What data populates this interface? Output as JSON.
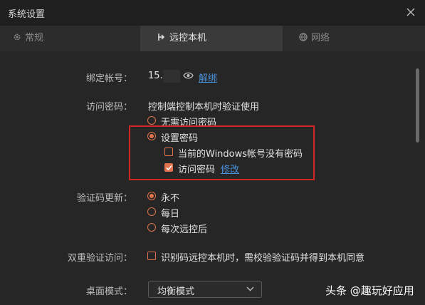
{
  "window": {
    "title": "系统设置"
  },
  "tabs": [
    {
      "label": "常规",
      "icon": "gear-icon"
    },
    {
      "label": "远控本机",
      "icon": "remote-control-icon"
    },
    {
      "label": "网络",
      "icon": "network-icon"
    }
  ],
  "account": {
    "label": "绑定帐号：",
    "value": "15.",
    "unbind": "解绑"
  },
  "access_password": {
    "label": "访问密码：",
    "description": "控制端控制本机时验证使用",
    "options": [
      "无需访问密码",
      "设置密码"
    ],
    "selected": "设置密码",
    "windows_no_password": "当前的Windows帐号没有密码",
    "access_password_checkbox": "访问密码",
    "modify": "修改"
  },
  "code_update": {
    "label": "验证码更新：",
    "options": [
      "永不",
      "每日",
      "每次远控后"
    ],
    "selected": "永不"
  },
  "double_verify": {
    "label": "双重验证访问：",
    "text": "识别码远控本机时，需校验验证码并得到本机同意"
  },
  "desktop_mode": {
    "label": "桌面模式：",
    "value": "均衡模式"
  },
  "watermark": "头条 @趣玩好应用",
  "colors": {
    "accent": "#e0734d",
    "link": "#4a90d9",
    "highlight_box": "#d02626"
  }
}
